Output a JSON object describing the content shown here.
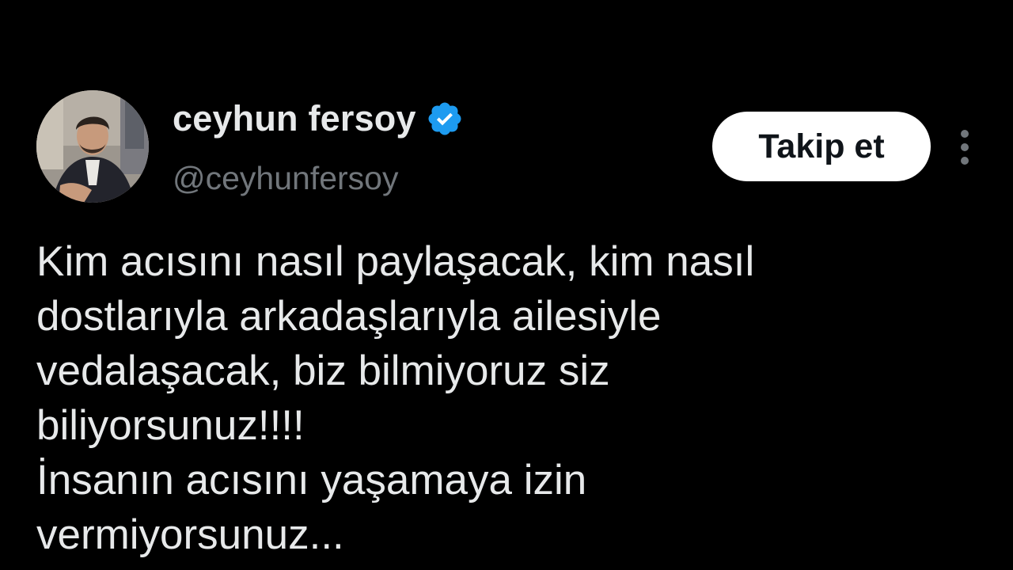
{
  "author": {
    "display_name": "ceyhun fersoy",
    "handle": "@ceyhunfersoy",
    "verified": true,
    "verified_color": "#1d9bf0"
  },
  "actions": {
    "follow_label": "Takip et",
    "more_icon": "more-vertical-icon"
  },
  "tweet": {
    "lines": [
      "Kim acısını nasıl paylaşacak, kim nasıl",
      "dostlarıyla arkadaşlarıyla ailesiyle",
      "vedalaşacak, biz bilmiyoruz siz",
      "biliyorsunuz!!!!",
      "İnsanın acısını yaşamaya izin",
      "vermiyorsunuz..."
    ]
  },
  "colors": {
    "background": "#000000",
    "text_primary": "#e7e9ea",
    "text_secondary": "#71767b",
    "button_bg": "#ffffff",
    "button_text": "#0f1419"
  }
}
